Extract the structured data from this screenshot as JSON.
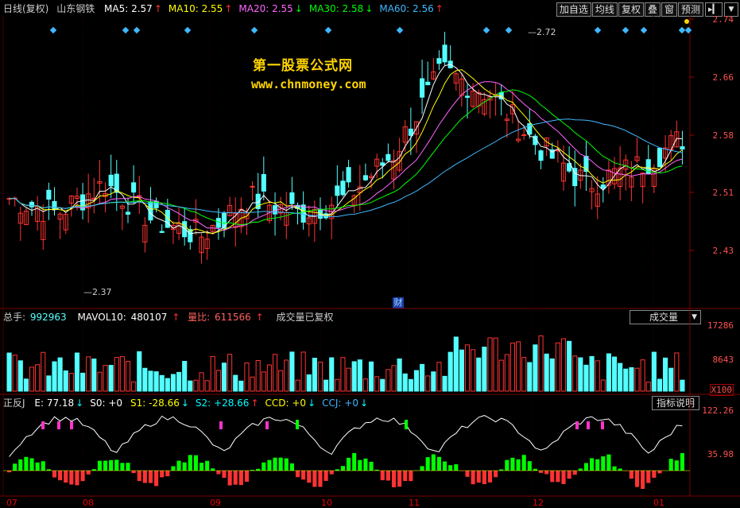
{
  "main": {
    "header": {
      "period": "日线(复权)",
      "stock": "山东钢铁",
      "ma": [
        {
          "label": "MA5: 2.57",
          "arrow": "↑",
          "color": "#ffffff",
          "acolor": "#ff3030"
        },
        {
          "label": "MA10: 2.55",
          "arrow": "↑",
          "color": "#ffff00",
          "acolor": "#ff3030"
        },
        {
          "label": "MA20: 2.55",
          "arrow": "↓",
          "color": "#ff66ff",
          "acolor": "#00ff00"
        },
        {
          "label": "MA30: 2.58",
          "arrow": "↓",
          "color": "#00ff00",
          "acolor": "#00ff00"
        },
        {
          "label": "MA60: 2.56",
          "arrow": "↑",
          "color": "#3fb8ff",
          "acolor": "#ff3030"
        }
      ]
    },
    "toolbar": [
      "加自选",
      "均线",
      "复权",
      "叠",
      "窗",
      "预测"
    ],
    "toolbar_arrow": "▸▎",
    "axis": [
      "2.74",
      "2.66",
      "2.58",
      "2.51",
      "2.43"
    ],
    "high_label": "2.72",
    "low_label": "2.37",
    "fin_marker": "财",
    "watermark1": "第一股票公式网",
    "watermark2": "www.chnmoney.com"
  },
  "volume": {
    "total_label": "总手:",
    "total_value": "992963",
    "mavol_label": "MAVOL10:",
    "mavol_value": "480107",
    "mavol_arrow": "↑",
    "ratio_label": "量比:",
    "ratio_value": "611566",
    "ratio_arrow": "↑",
    "note": "成交量已复权",
    "selector": "成交量",
    "axis": [
      "17286",
      "8643",
      "X100"
    ]
  },
  "indicator": {
    "name": "正反J",
    "items": [
      {
        "label": "E: 77.18",
        "arrow": "↓",
        "color": "#ffffff"
      },
      {
        "label": "S0: +0",
        "arrow": "",
        "color": "#ffffff"
      },
      {
        "label": "S1: -28.66",
        "arrow": "↓",
        "color": "#ffff00"
      },
      {
        "label": "S2: +28.66",
        "arrow": "↑",
        "color": "#00ffff"
      },
      {
        "label": "CCD: +0",
        "arrow": "↓",
        "color": "#ffff00"
      },
      {
        "label": "CCJ: +0",
        "arrow": "↓",
        "color": "#3fb8ff"
      }
    ],
    "help_button": "指标说明",
    "axis": [
      "122.26",
      "35.98"
    ]
  },
  "xaxis": [
    "07",
    "08",
    "09",
    "10",
    "11",
    "12",
    "01"
  ],
  "colors": {
    "up": "#ff3333",
    "down": "#54ffff",
    "grid": "#7a0000"
  }
}
